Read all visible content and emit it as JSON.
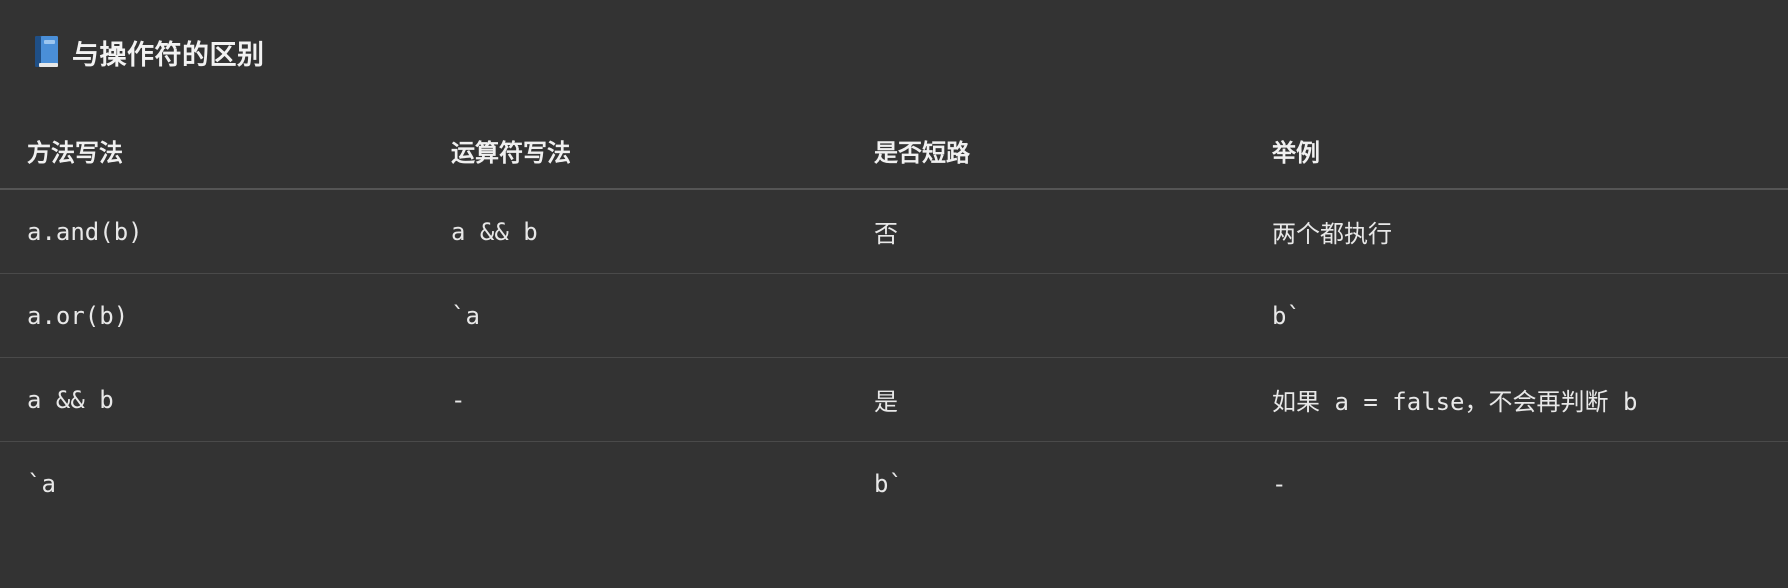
{
  "heading": {
    "icon": "blue-book-icon",
    "title": "与操作符的区别"
  },
  "table": {
    "headers": [
      "方法写法",
      "运算符写法",
      "是否短路",
      "举例"
    ],
    "rows": [
      [
        "a.and(b)",
        "a && b",
        "否",
        "两个都执行"
      ],
      [
        "a.or(b)",
        "`a",
        "",
        "b`"
      ],
      [
        "a && b",
        "-",
        "是",
        "如果 a = false，不会再判断 b"
      ],
      [
        "`a",
        "",
        "b`",
        "-"
      ]
    ]
  },
  "colors": {
    "background": "#333333",
    "text": "#ececec",
    "divider": "#4a4a4a",
    "book_blue": "#3b7dc4"
  }
}
